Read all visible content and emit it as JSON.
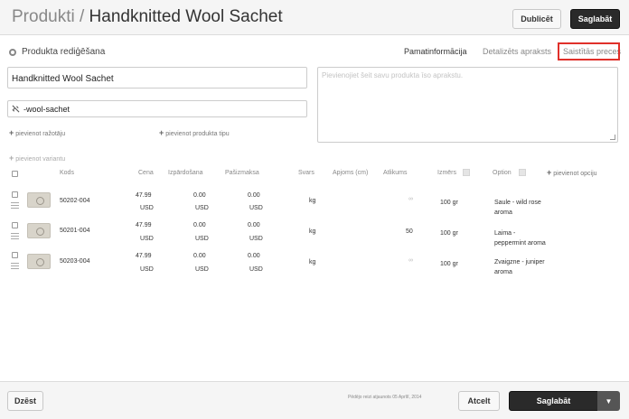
{
  "header": {
    "breadcrumb": "Produkti",
    "separator": " / ",
    "title": "Handknitted Wool Sachet",
    "duplicate_label": "Dublicēt",
    "save_label": "Saglabāt"
  },
  "section": {
    "title": "Produkta rediģēšana"
  },
  "tabs": [
    {
      "label": "Pamatinformācija",
      "active": true
    },
    {
      "label": "Detalizēts apraksts",
      "active": false
    },
    {
      "label": "Saistītās preces",
      "active": false,
      "highlighted": true
    }
  ],
  "form": {
    "name_value": "Handknitted Wool Sachet",
    "slug_value": "-wool-sachet",
    "description_placeholder": "Pievienojiet šeit savu produkta īso aprakstu.",
    "add_manufacturer": "pievienot ražotāju",
    "add_product_type": "pievienot produkta tipu",
    "add_variant": "pievienot variantu",
    "add_option": "pievienot opciju"
  },
  "table": {
    "columns": {
      "code": "Kods",
      "price": "Cena",
      "sale": "Izpārdošana",
      "cost": "Pašizmaksa",
      "weight": "Svars",
      "volume": "Apjoms (cm)",
      "stock": "Atlikums",
      "size": "Izmērs",
      "option": "Option"
    },
    "rows": [
      {
        "code": "50202-004",
        "price": "47.99",
        "price_cur": "USD",
        "sale": "0.00",
        "sale_cur": "USD",
        "cost": "0.00",
        "cost_cur": "USD",
        "weight": "kg",
        "stock": "∞",
        "size": "100 gr",
        "option": "Saule - wild rose aroma"
      },
      {
        "code": "50201-004",
        "price": "47.99",
        "price_cur": "USD",
        "sale": "0.00",
        "sale_cur": "USD",
        "cost": "0.00",
        "cost_cur": "USD",
        "weight": "kg",
        "stock": "50",
        "size": "100 gr",
        "option": "Laima - peppermint aroma"
      },
      {
        "code": "50203-004",
        "price": "47.99",
        "price_cur": "USD",
        "sale": "0.00",
        "sale_cur": "USD",
        "cost": "0.00",
        "cost_cur": "USD",
        "weight": "kg",
        "stock": "∞",
        "size": "100 gr",
        "option": "Zvaigzne - juniper aroma"
      }
    ]
  },
  "footer": {
    "delete_label": "Dzēst",
    "last_updated": "Pēdējo reizi atjaunots 05 Aprīlī, 2014",
    "cancel_label": "Atcelt",
    "save_label": "Saglabāt",
    "caret": "▼"
  },
  "colors": {
    "accent_dark": "#2a2a2a",
    "highlight": "#e0302a"
  }
}
